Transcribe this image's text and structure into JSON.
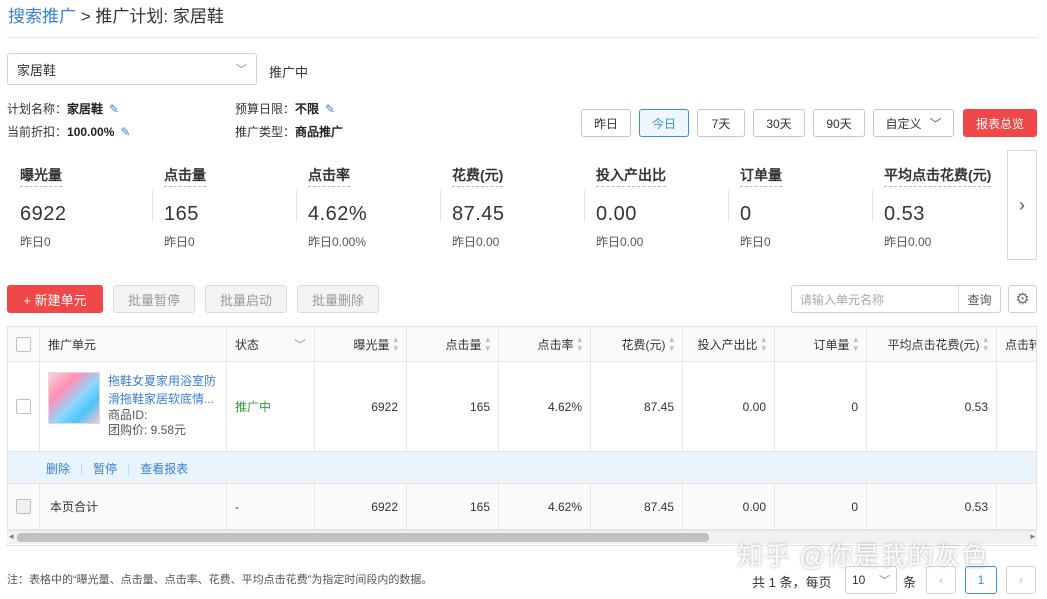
{
  "breadcrumb": {
    "root": "搜索推广",
    "sep": ">",
    "current": "推广计划: 家居鞋"
  },
  "plan_select": {
    "value": "家居鞋"
  },
  "plan_status": "推广中",
  "info": {
    "name_label": "计划名称：",
    "name_value": "家居鞋",
    "discount_label": "当前折扣：",
    "discount_value": "100.00%",
    "budget_label": "预算日限：",
    "budget_value": "不限",
    "type_label": "推广类型：",
    "type_value": "商品推广"
  },
  "date_buttons": [
    "昨日",
    "今日",
    "7天",
    "30天",
    "90天"
  ],
  "date_active": "今日",
  "custom_label": "自定义",
  "report_button": "报表总览",
  "metrics": [
    {
      "label": "曝光量",
      "value": "6922",
      "prev": "昨日0"
    },
    {
      "label": "点击量",
      "value": "165",
      "prev": "昨日0"
    },
    {
      "label": "点击率",
      "value": "4.62%",
      "prev": "昨日0.00%"
    },
    {
      "label": "花费(元)",
      "value": "87.45",
      "prev": "昨日0.00"
    },
    {
      "label": "投入产出比",
      "value": "0.00",
      "prev": "昨日0.00"
    },
    {
      "label": "订单量",
      "value": "0",
      "prev": "昨日0"
    },
    {
      "label": "平均点击花费(元)",
      "value": "0.53",
      "prev": "昨日0.00"
    }
  ],
  "toolbar": {
    "new_unit": "+ 新建单元",
    "batch_pause": "批量暂停",
    "batch_start": "批量启动",
    "batch_delete": "批量删除",
    "search_placeholder": "请输入单元名称",
    "search_button": "查询"
  },
  "table": {
    "headers": [
      "推广单元",
      "状态",
      "曝光量",
      "点击量",
      "点击率",
      "花费(元)",
      "投入产出比",
      "订单量",
      "平均点击花费(元)",
      "点击转"
    ],
    "row": {
      "title": "拖鞋女夏家用浴室防滑拖鞋家居软底情...",
      "product_id_label": "商品ID:",
      "group_price": "团购价: 9.58元",
      "status": "推广中",
      "impressions": "6922",
      "clicks": "165",
      "ctr": "4.62%",
      "cost": "87.45",
      "roi": "0.00",
      "orders": "0",
      "cpc": "0.53"
    },
    "actions": [
      "删除",
      "暂停",
      "查看报表"
    ],
    "total": {
      "label": "本页合计",
      "status": "-",
      "impressions": "6922",
      "clicks": "165",
      "ctr": "4.62%",
      "cost": "87.45",
      "roi": "0.00",
      "orders": "0",
      "cpc": "0.53"
    }
  },
  "note": "注：表格中的“曝光量、点击量、点击率、花费、平均点击花费”为指定时间段内的数据。",
  "watermark": "知乎 @你是我的灰色",
  "pagination": {
    "total_text": "共 1 条，每页",
    "page_size": "10",
    "unit": "条",
    "current_page": "1"
  }
}
